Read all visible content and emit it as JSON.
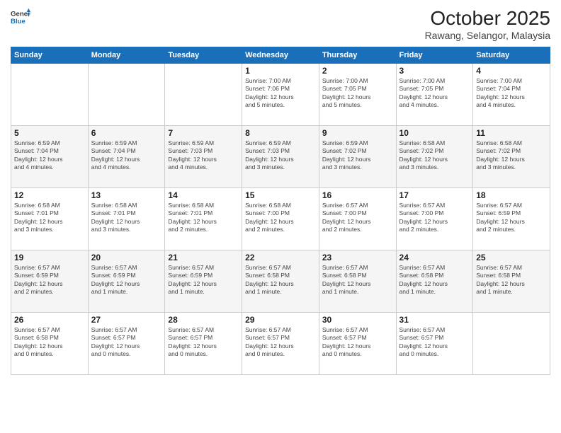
{
  "header": {
    "logo_general": "General",
    "logo_blue": "Blue",
    "month_title": "October 2025",
    "location": "Rawang, Selangor, Malaysia"
  },
  "weekdays": [
    "Sunday",
    "Monday",
    "Tuesday",
    "Wednesday",
    "Thursday",
    "Friday",
    "Saturday"
  ],
  "weeks": [
    [
      {
        "day": "",
        "info": ""
      },
      {
        "day": "",
        "info": ""
      },
      {
        "day": "",
        "info": ""
      },
      {
        "day": "1",
        "info": "Sunrise: 7:00 AM\nSunset: 7:06 PM\nDaylight: 12 hours\nand 5 minutes."
      },
      {
        "day": "2",
        "info": "Sunrise: 7:00 AM\nSunset: 7:05 PM\nDaylight: 12 hours\nand 5 minutes."
      },
      {
        "day": "3",
        "info": "Sunrise: 7:00 AM\nSunset: 7:05 PM\nDaylight: 12 hours\nand 4 minutes."
      },
      {
        "day": "4",
        "info": "Sunrise: 7:00 AM\nSunset: 7:04 PM\nDaylight: 12 hours\nand 4 minutes."
      }
    ],
    [
      {
        "day": "5",
        "info": "Sunrise: 6:59 AM\nSunset: 7:04 PM\nDaylight: 12 hours\nand 4 minutes."
      },
      {
        "day": "6",
        "info": "Sunrise: 6:59 AM\nSunset: 7:04 PM\nDaylight: 12 hours\nand 4 minutes."
      },
      {
        "day": "7",
        "info": "Sunrise: 6:59 AM\nSunset: 7:03 PM\nDaylight: 12 hours\nand 4 minutes."
      },
      {
        "day": "8",
        "info": "Sunrise: 6:59 AM\nSunset: 7:03 PM\nDaylight: 12 hours\nand 3 minutes."
      },
      {
        "day": "9",
        "info": "Sunrise: 6:59 AM\nSunset: 7:02 PM\nDaylight: 12 hours\nand 3 minutes."
      },
      {
        "day": "10",
        "info": "Sunrise: 6:58 AM\nSunset: 7:02 PM\nDaylight: 12 hours\nand 3 minutes."
      },
      {
        "day": "11",
        "info": "Sunrise: 6:58 AM\nSunset: 7:02 PM\nDaylight: 12 hours\nand 3 minutes."
      }
    ],
    [
      {
        "day": "12",
        "info": "Sunrise: 6:58 AM\nSunset: 7:01 PM\nDaylight: 12 hours\nand 3 minutes."
      },
      {
        "day": "13",
        "info": "Sunrise: 6:58 AM\nSunset: 7:01 PM\nDaylight: 12 hours\nand 3 minutes."
      },
      {
        "day": "14",
        "info": "Sunrise: 6:58 AM\nSunset: 7:01 PM\nDaylight: 12 hours\nand 2 minutes."
      },
      {
        "day": "15",
        "info": "Sunrise: 6:58 AM\nSunset: 7:00 PM\nDaylight: 12 hours\nand 2 minutes."
      },
      {
        "day": "16",
        "info": "Sunrise: 6:57 AM\nSunset: 7:00 PM\nDaylight: 12 hours\nand 2 minutes."
      },
      {
        "day": "17",
        "info": "Sunrise: 6:57 AM\nSunset: 7:00 PM\nDaylight: 12 hours\nand 2 minutes."
      },
      {
        "day": "18",
        "info": "Sunrise: 6:57 AM\nSunset: 6:59 PM\nDaylight: 12 hours\nand 2 minutes."
      }
    ],
    [
      {
        "day": "19",
        "info": "Sunrise: 6:57 AM\nSunset: 6:59 PM\nDaylight: 12 hours\nand 2 minutes."
      },
      {
        "day": "20",
        "info": "Sunrise: 6:57 AM\nSunset: 6:59 PM\nDaylight: 12 hours\nand 1 minute."
      },
      {
        "day": "21",
        "info": "Sunrise: 6:57 AM\nSunset: 6:59 PM\nDaylight: 12 hours\nand 1 minute."
      },
      {
        "day": "22",
        "info": "Sunrise: 6:57 AM\nSunset: 6:58 PM\nDaylight: 12 hours\nand 1 minute."
      },
      {
        "day": "23",
        "info": "Sunrise: 6:57 AM\nSunset: 6:58 PM\nDaylight: 12 hours\nand 1 minute."
      },
      {
        "day": "24",
        "info": "Sunrise: 6:57 AM\nSunset: 6:58 PM\nDaylight: 12 hours\nand 1 minute."
      },
      {
        "day": "25",
        "info": "Sunrise: 6:57 AM\nSunset: 6:58 PM\nDaylight: 12 hours\nand 1 minute."
      }
    ],
    [
      {
        "day": "26",
        "info": "Sunrise: 6:57 AM\nSunset: 6:58 PM\nDaylight: 12 hours\nand 0 minutes."
      },
      {
        "day": "27",
        "info": "Sunrise: 6:57 AM\nSunset: 6:57 PM\nDaylight: 12 hours\nand 0 minutes."
      },
      {
        "day": "28",
        "info": "Sunrise: 6:57 AM\nSunset: 6:57 PM\nDaylight: 12 hours\nand 0 minutes."
      },
      {
        "day": "29",
        "info": "Sunrise: 6:57 AM\nSunset: 6:57 PM\nDaylight: 12 hours\nand 0 minutes."
      },
      {
        "day": "30",
        "info": "Sunrise: 6:57 AM\nSunset: 6:57 PM\nDaylight: 12 hours\nand 0 minutes."
      },
      {
        "day": "31",
        "info": "Sunrise: 6:57 AM\nSunset: 6:57 PM\nDaylight: 12 hours\nand 0 minutes."
      },
      {
        "day": "",
        "info": ""
      }
    ]
  ]
}
